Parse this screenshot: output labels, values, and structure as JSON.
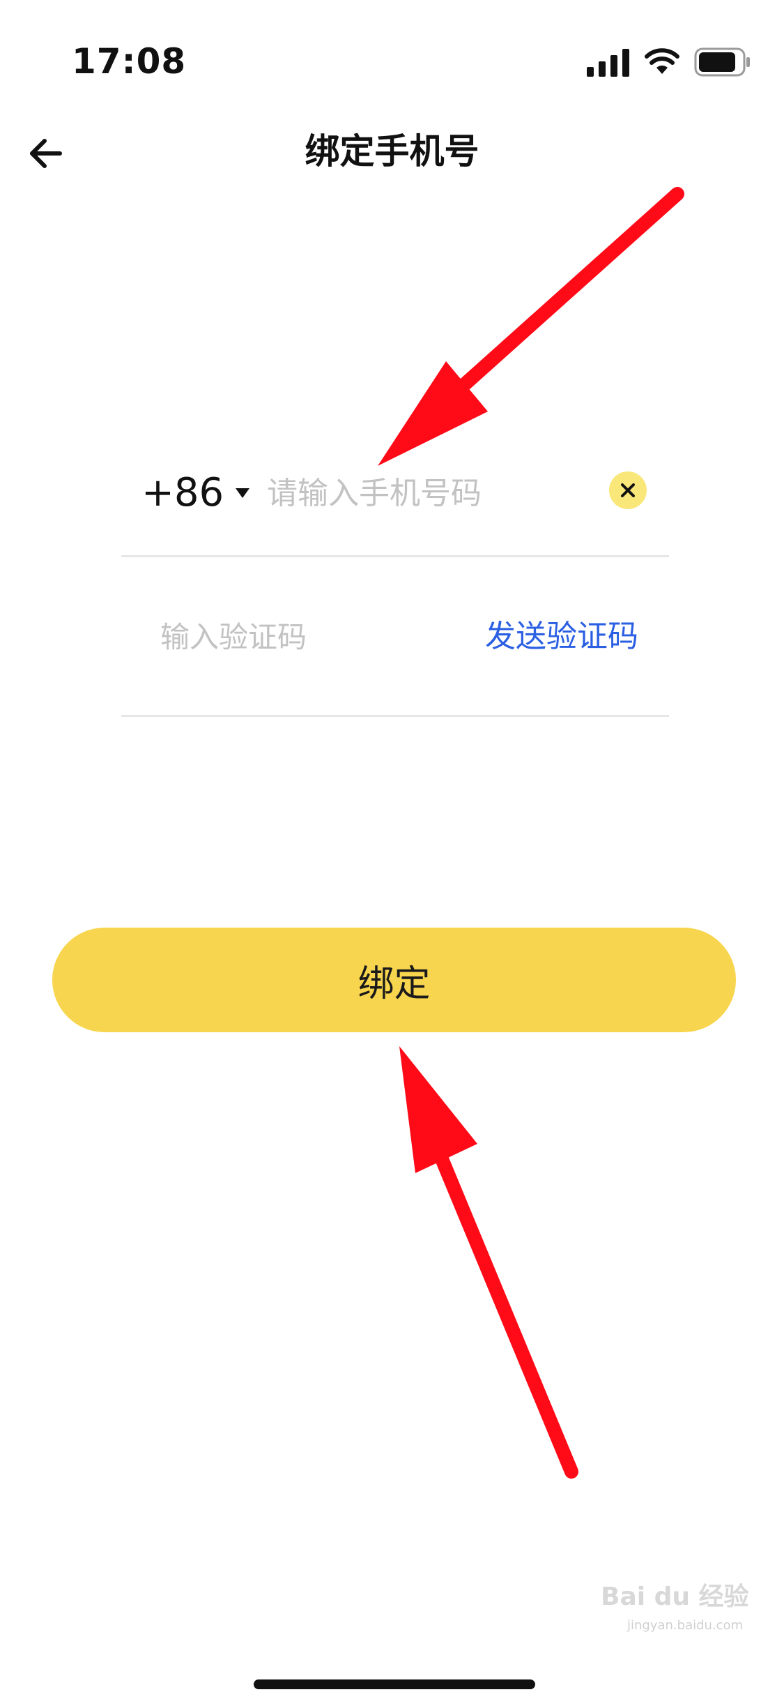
{
  "status_bar": {
    "time": "17:08",
    "icons": [
      "signal-icon",
      "wifi-icon",
      "battery-icon"
    ]
  },
  "nav": {
    "back_icon": "arrow-left-icon",
    "title": "绑定手机号"
  },
  "phone_row": {
    "country_code": "+86",
    "dropdown_icon": "caret-down-icon",
    "placeholder": "请输入手机号码",
    "value": "",
    "clear_icon": "close-icon"
  },
  "code_row": {
    "placeholder": "输入验证码",
    "value": "",
    "send_label": "发送验证码"
  },
  "bind_button": {
    "label": "绑定"
  },
  "watermark": {
    "text": "Bai du 经验",
    "sub": "jingyan.baidu.com"
  },
  "colors": {
    "accent_yellow": "#f8d54e",
    "clear_button_bg": "#f9e77a",
    "link_blue": "#2b5fe3",
    "placeholder_gray": "#c2c2c2",
    "annotation_red": "#ff0a17"
  }
}
